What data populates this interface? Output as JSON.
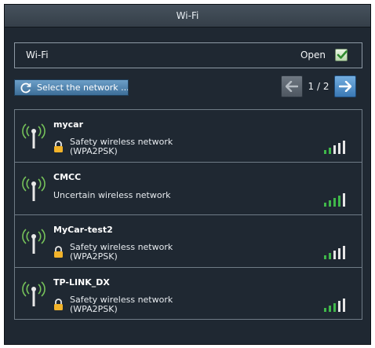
{
  "window": {
    "title": "Wi-Fi"
  },
  "wifi": {
    "label": "Wi-Fi",
    "status_label": "Open",
    "enabled": true
  },
  "select_button": {
    "label": "Select the network ..."
  },
  "pager": {
    "current": 1,
    "total": 2,
    "text": "1 / 2"
  },
  "networks": [
    {
      "name": "mycar",
      "secured": true,
      "security_line1": "Safety wireless network",
      "security_line2": "(WPA2PSK)",
      "signal_bars": 2
    },
    {
      "name": "CMCC",
      "secured": false,
      "security_line1": "Uncertain wireless network",
      "security_line2": "",
      "signal_bars": 4
    },
    {
      "name": "MyCar-test2",
      "secured": true,
      "security_line1": "Safety wireless network",
      "security_line2": "(WPA2PSK)",
      "signal_bars": 2
    },
    {
      "name": "TP-LINK_DX",
      "secured": true,
      "security_line1": "Safety wireless network",
      "security_line2": "(WPA2PSK)",
      "signal_bars": 3
    }
  ],
  "colors": {
    "panel_bg": "#1f2832",
    "signal_active": "#3fb74a",
    "signal_inactive": "#e6e6e6",
    "accent_blue": "#3a79b5",
    "lock": "#f2b32a"
  }
}
